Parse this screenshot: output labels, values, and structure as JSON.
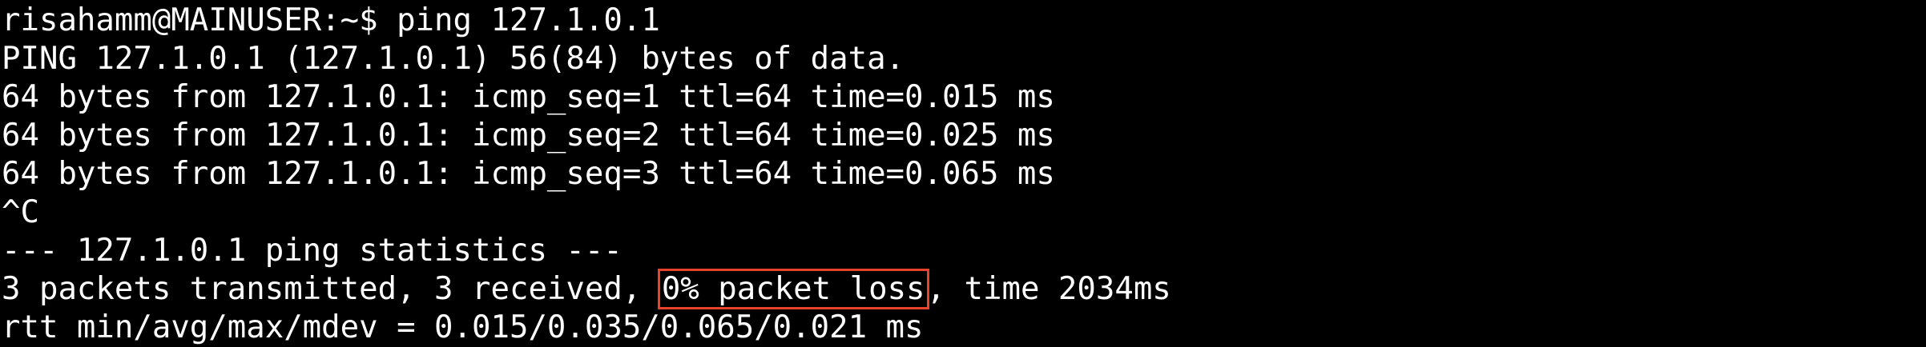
{
  "terminal": {
    "lines": [
      "risahamm@MAINUSER:~$ ping 127.1.0.1",
      "PING 127.1.0.1 (127.1.0.1) 56(84) bytes of data.",
      "64 bytes from 127.1.0.1: icmp_seq=1 ttl=64 time=0.015 ms",
      "64 bytes from 127.1.0.1: icmp_seq=2 ttl=64 time=0.025 ms",
      "64 bytes from 127.1.0.1: icmp_seq=3 ttl=64 time=0.065 ms",
      "^C",
      "--- 127.1.0.1 ping statistics ---",
      {
        "before": "3 packets transmitted, 3 received, ",
        "highlighted": "0% packet loss",
        "after": ", time 2034ms"
      },
      "rtt min/avg/max/mdev = 0.015/0.035/0.065/0.021 ms"
    ],
    "highlight_color": "#e8422c",
    "background": "#000000",
    "foreground": "#ffffff"
  }
}
